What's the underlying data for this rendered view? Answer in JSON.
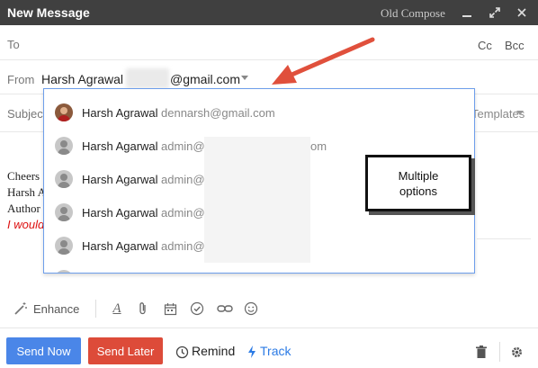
{
  "window": {
    "title": "New Message",
    "old_compose": "Old Compose",
    "minimize": "‒",
    "expand": "⤢",
    "close": "✕"
  },
  "header": {
    "to_label": "To",
    "cc_label": "Cc",
    "bcc_label": "Bcc",
    "from_label": "From",
    "from_name": "Harsh Agrawal",
    "from_email_domain": "@gmail.com",
    "subject_label": "Subject",
    "templates_label": "Templates"
  },
  "dropdown": {
    "items": [
      {
        "name": "Harsh Agrawal",
        "email": "dennarsh@gmail.com",
        "avatar": "photo"
      },
      {
        "name": "Harsh Agarwal",
        "email": "admin@",
        "email_tail": "om",
        "avatar": "default"
      },
      {
        "name": "Harsh Agarwal",
        "email": "admin@",
        "avatar": "default"
      },
      {
        "name": "Harsh Agarwal",
        "email": "admin@",
        "avatar": "default"
      },
      {
        "name": "Harsh Agarwal",
        "email": "admin@",
        "avatar": "default"
      }
    ]
  },
  "body": {
    "line1": "Cheers",
    "line2": "Harsh A",
    "line3": "Author",
    "line4": "I would"
  },
  "annotation": {
    "callout_line1": "Multiple",
    "callout_line2": "options",
    "arrow_color": "#e0503c"
  },
  "toolbar": {
    "enhance_label": "Enhance"
  },
  "footer": {
    "send_now": "Send Now",
    "send_later": "Send Later",
    "remind": "Remind",
    "track": "Track"
  },
  "colors": {
    "titlebar": "#404040",
    "send_now": "#4a86e8",
    "send_later": "#dd4b39",
    "track": "#2c7be5",
    "dropdown_border": "#6d9eeb"
  }
}
